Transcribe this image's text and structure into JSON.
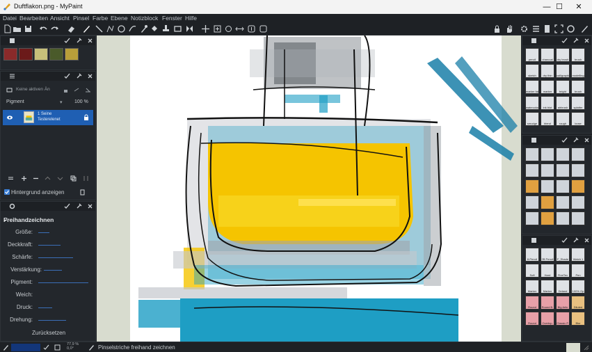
{
  "window": {
    "title": "Duftflakon.png - MyPaint",
    "minimize": "—",
    "maximize": "☐",
    "close": "✕"
  },
  "menu": [
    "Datei",
    "Bearbeiten",
    "Ansicht",
    "Pinsel",
    "Farbe",
    "Ebene",
    "Notizblock",
    "Fenster",
    "Hilfe"
  ],
  "colors": {
    "accent": "#1f5fb3",
    "panel_bg": "#23272c",
    "canvas_paper": "#ffffff",
    "yellow": "#f5c400",
    "cyan": "#1e9ec4"
  },
  "layers_panel": {
    "mode_value": "Keine aktiven Än",
    "blend_mode": "Pigment",
    "opacity": "100 %",
    "layer_name_line1": "1 Seine",
    "layer_name_line2": "Testerelenet",
    "show_background": "Hintergrund anzeigen"
  },
  "tool_options": {
    "tool_name": "Freihandzeichnen",
    "params": [
      "Größe:",
      "Deckkraft:",
      "Schärfe:",
      "Verstärkung:",
      "Pigment:",
      "Weich:",
      "Druck:",
      "Drehung:"
    ],
    "reset": "Zurücksetzen"
  },
  "brush_groups": {
    "group1": [
      "pencil",
      "charcoal",
      "dry brush",
      "brush",
      "sketch",
      "dry thin",
      "calligraphic",
      "modelling",
      "marker fat",
      "marker",
      "bright",
      "brush",
      "watercolour",
      "ink blot",
      "airbrush",
      "splatter",
      "smudge",
      "blend",
      "rough",
      "loose"
    ],
    "group3": [
      "8-Pencil",
      "2B Pencil",
      "F_Shade",
      "Watch 1",
      "Soft",
      "Hard",
      "FineTex",
      "Pen",
      "Marker",
      "Marker",
      "Deland",
      "100% Op",
      "Round",
      "Round B.",
      "Big Artic",
      "Diluted",
      "Round",
      "Overtop.",
      "Classic P.",
      "Blur"
    ]
  },
  "status": {
    "zoom": "77,9 %",
    "rotation": "0,0°",
    "message": "Pinselstriche freihand zeichnen"
  }
}
